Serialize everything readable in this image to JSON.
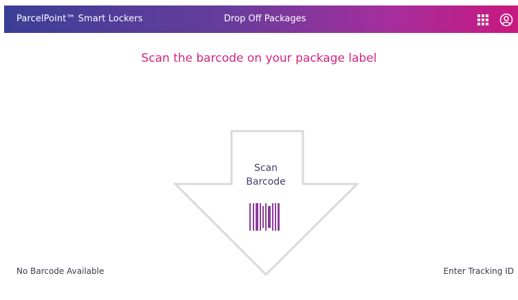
{
  "header": {
    "app_title": "ParcelPoint™ Smart Lockers",
    "page_title": "Drop Off Packages",
    "apps_icon": "grid-apps-icon",
    "account_icon": "user-account-icon"
  },
  "main": {
    "instruction": "Scan the barcode on your package label",
    "scan_label_line1": "Scan",
    "scan_label_line2": "Barcode",
    "barcode_icon": "barcode-icon"
  },
  "footer": {
    "no_barcode_link": "No Barcode Available",
    "enter_tracking_link": "Enter Tracking ID"
  },
  "colors": {
    "header_gradient_start": "#3b3e96",
    "header_gradient_end": "#c8197f",
    "accent_pink": "#d4237f",
    "arrow_outline": "#d9d9d9",
    "barcode_purple": "#8a3c9c"
  }
}
